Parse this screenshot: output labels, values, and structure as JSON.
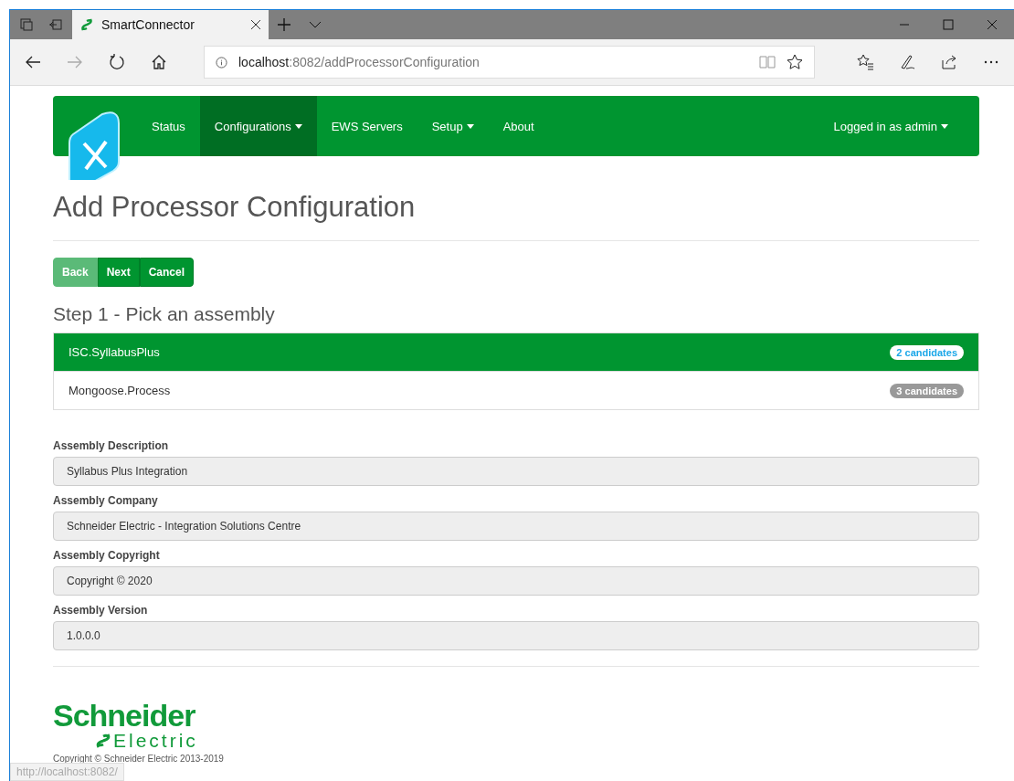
{
  "browser": {
    "tab_title": "SmartConnector",
    "address_host": "localhost",
    "address_path": ":8082/addProcessorConfiguration",
    "status_url": "http://localhost:8082/"
  },
  "nav": {
    "items": [
      {
        "label": "Status",
        "selected": false,
        "dropdown": false
      },
      {
        "label": "Configurations",
        "selected": true,
        "dropdown": true
      },
      {
        "label": "EWS Servers",
        "selected": false,
        "dropdown": false
      },
      {
        "label": "Setup",
        "selected": false,
        "dropdown": true
      },
      {
        "label": "About",
        "selected": false,
        "dropdown": false
      }
    ],
    "user": "Logged in as admin"
  },
  "page": {
    "title": "Add Processor Configuration",
    "buttons": [
      {
        "label": "Back",
        "disabled": true
      },
      {
        "label": "Next",
        "disabled": false
      },
      {
        "label": "Cancel",
        "disabled": false
      }
    ],
    "step_title": "Step 1 - Pick an assembly",
    "assemblies": [
      {
        "name": "ISC.SyllabusPlus",
        "badge": "2 candidates",
        "selected": true
      },
      {
        "name": "Mongoose.Process",
        "badge": "3 candidates",
        "selected": false
      }
    ],
    "fields": [
      {
        "label": "Assembly Description",
        "value": "Syllabus Plus Integration"
      },
      {
        "label": "Assembly Company",
        "value": "Schneider Electric - Integration Solutions Centre"
      },
      {
        "label": "Assembly Copyright",
        "value": "Copyright ©  2020"
      },
      {
        "label": "Assembly Version",
        "value": "1.0.0.0"
      }
    ]
  },
  "footer": {
    "logo_top": "Schneider",
    "logo_bottom": "Electric",
    "copyright": "Copyright © Schneider Electric 2013-2019"
  }
}
